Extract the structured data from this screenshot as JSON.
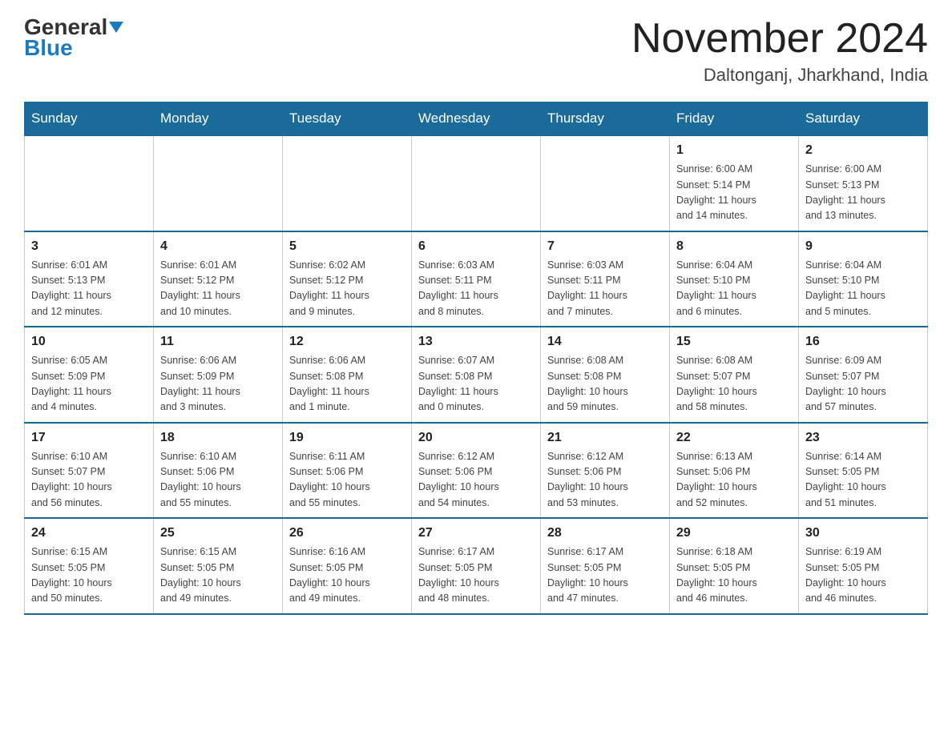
{
  "header": {
    "logo_general": "General",
    "logo_blue": "Blue",
    "month_year": "November 2024",
    "location": "Daltonganj, Jharkhand, India"
  },
  "days_of_week": [
    "Sunday",
    "Monday",
    "Tuesday",
    "Wednesday",
    "Thursday",
    "Friday",
    "Saturday"
  ],
  "weeks": [
    [
      {
        "day": "",
        "info": ""
      },
      {
        "day": "",
        "info": ""
      },
      {
        "day": "",
        "info": ""
      },
      {
        "day": "",
        "info": ""
      },
      {
        "day": "",
        "info": ""
      },
      {
        "day": "1",
        "info": "Sunrise: 6:00 AM\nSunset: 5:14 PM\nDaylight: 11 hours\nand 14 minutes."
      },
      {
        "day": "2",
        "info": "Sunrise: 6:00 AM\nSunset: 5:13 PM\nDaylight: 11 hours\nand 13 minutes."
      }
    ],
    [
      {
        "day": "3",
        "info": "Sunrise: 6:01 AM\nSunset: 5:13 PM\nDaylight: 11 hours\nand 12 minutes."
      },
      {
        "day": "4",
        "info": "Sunrise: 6:01 AM\nSunset: 5:12 PM\nDaylight: 11 hours\nand 10 minutes."
      },
      {
        "day": "5",
        "info": "Sunrise: 6:02 AM\nSunset: 5:12 PM\nDaylight: 11 hours\nand 9 minutes."
      },
      {
        "day": "6",
        "info": "Sunrise: 6:03 AM\nSunset: 5:11 PM\nDaylight: 11 hours\nand 8 minutes."
      },
      {
        "day": "7",
        "info": "Sunrise: 6:03 AM\nSunset: 5:11 PM\nDaylight: 11 hours\nand 7 minutes."
      },
      {
        "day": "8",
        "info": "Sunrise: 6:04 AM\nSunset: 5:10 PM\nDaylight: 11 hours\nand 6 minutes."
      },
      {
        "day": "9",
        "info": "Sunrise: 6:04 AM\nSunset: 5:10 PM\nDaylight: 11 hours\nand 5 minutes."
      }
    ],
    [
      {
        "day": "10",
        "info": "Sunrise: 6:05 AM\nSunset: 5:09 PM\nDaylight: 11 hours\nand 4 minutes."
      },
      {
        "day": "11",
        "info": "Sunrise: 6:06 AM\nSunset: 5:09 PM\nDaylight: 11 hours\nand 3 minutes."
      },
      {
        "day": "12",
        "info": "Sunrise: 6:06 AM\nSunset: 5:08 PM\nDaylight: 11 hours\nand 1 minute."
      },
      {
        "day": "13",
        "info": "Sunrise: 6:07 AM\nSunset: 5:08 PM\nDaylight: 11 hours\nand 0 minutes."
      },
      {
        "day": "14",
        "info": "Sunrise: 6:08 AM\nSunset: 5:08 PM\nDaylight: 10 hours\nand 59 minutes."
      },
      {
        "day": "15",
        "info": "Sunrise: 6:08 AM\nSunset: 5:07 PM\nDaylight: 10 hours\nand 58 minutes."
      },
      {
        "day": "16",
        "info": "Sunrise: 6:09 AM\nSunset: 5:07 PM\nDaylight: 10 hours\nand 57 minutes."
      }
    ],
    [
      {
        "day": "17",
        "info": "Sunrise: 6:10 AM\nSunset: 5:07 PM\nDaylight: 10 hours\nand 56 minutes."
      },
      {
        "day": "18",
        "info": "Sunrise: 6:10 AM\nSunset: 5:06 PM\nDaylight: 10 hours\nand 55 minutes."
      },
      {
        "day": "19",
        "info": "Sunrise: 6:11 AM\nSunset: 5:06 PM\nDaylight: 10 hours\nand 55 minutes."
      },
      {
        "day": "20",
        "info": "Sunrise: 6:12 AM\nSunset: 5:06 PM\nDaylight: 10 hours\nand 54 minutes."
      },
      {
        "day": "21",
        "info": "Sunrise: 6:12 AM\nSunset: 5:06 PM\nDaylight: 10 hours\nand 53 minutes."
      },
      {
        "day": "22",
        "info": "Sunrise: 6:13 AM\nSunset: 5:06 PM\nDaylight: 10 hours\nand 52 minutes."
      },
      {
        "day": "23",
        "info": "Sunrise: 6:14 AM\nSunset: 5:05 PM\nDaylight: 10 hours\nand 51 minutes."
      }
    ],
    [
      {
        "day": "24",
        "info": "Sunrise: 6:15 AM\nSunset: 5:05 PM\nDaylight: 10 hours\nand 50 minutes."
      },
      {
        "day": "25",
        "info": "Sunrise: 6:15 AM\nSunset: 5:05 PM\nDaylight: 10 hours\nand 49 minutes."
      },
      {
        "day": "26",
        "info": "Sunrise: 6:16 AM\nSunset: 5:05 PM\nDaylight: 10 hours\nand 49 minutes."
      },
      {
        "day": "27",
        "info": "Sunrise: 6:17 AM\nSunset: 5:05 PM\nDaylight: 10 hours\nand 48 minutes."
      },
      {
        "day": "28",
        "info": "Sunrise: 6:17 AM\nSunset: 5:05 PM\nDaylight: 10 hours\nand 47 minutes."
      },
      {
        "day": "29",
        "info": "Sunrise: 6:18 AM\nSunset: 5:05 PM\nDaylight: 10 hours\nand 46 minutes."
      },
      {
        "day": "30",
        "info": "Sunrise: 6:19 AM\nSunset: 5:05 PM\nDaylight: 10 hours\nand 46 minutes."
      }
    ]
  ]
}
